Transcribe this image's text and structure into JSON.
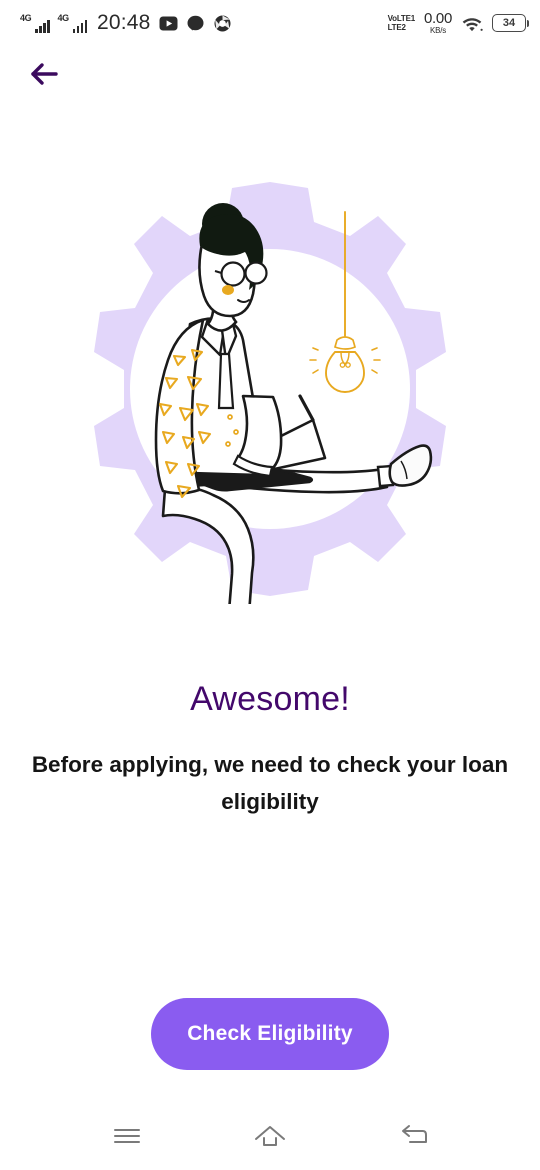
{
  "status_bar": {
    "sim1_network": "4G",
    "sim2_network": "4G",
    "time": "20:48",
    "app_icons": [
      "youtube-icon",
      "messenger-icon",
      "chrome-icon"
    ],
    "volte_line1": "VoLTE1",
    "volte_line2": "LTE2",
    "data_speed_value": "0.00",
    "data_speed_unit": "KB/s",
    "wifi_icon": "wifi-icon",
    "battery_level": "34"
  },
  "app_bar": {
    "back_icon": "arrow-left-icon",
    "back_color": "#3b0a5e"
  },
  "illustration": {
    "name": "woman-on-gear-with-laptop",
    "gear_color": "#e2d6fa",
    "inner_circle_color": "#ffffff",
    "hair_color": "#111a11",
    "accent_color": "#e8a920",
    "outline_color": "#1a1a1a",
    "bulb_label": "hanging-lightbulb"
  },
  "content": {
    "headline": "Awesome!",
    "headline_color": "#43086b",
    "subtext": "Before applying, we need to check your loan eligibility",
    "subtext_color": "#151515"
  },
  "cta": {
    "label": "Check Eligibility",
    "background": "#8a5cf0",
    "text_color": "#ffffff"
  },
  "nav_bar": {
    "recents_icon": "menu-lines-icon",
    "home_icon": "home-outline-icon",
    "back_icon": "back-undo-icon",
    "icon_color": "#7a7a7a"
  }
}
